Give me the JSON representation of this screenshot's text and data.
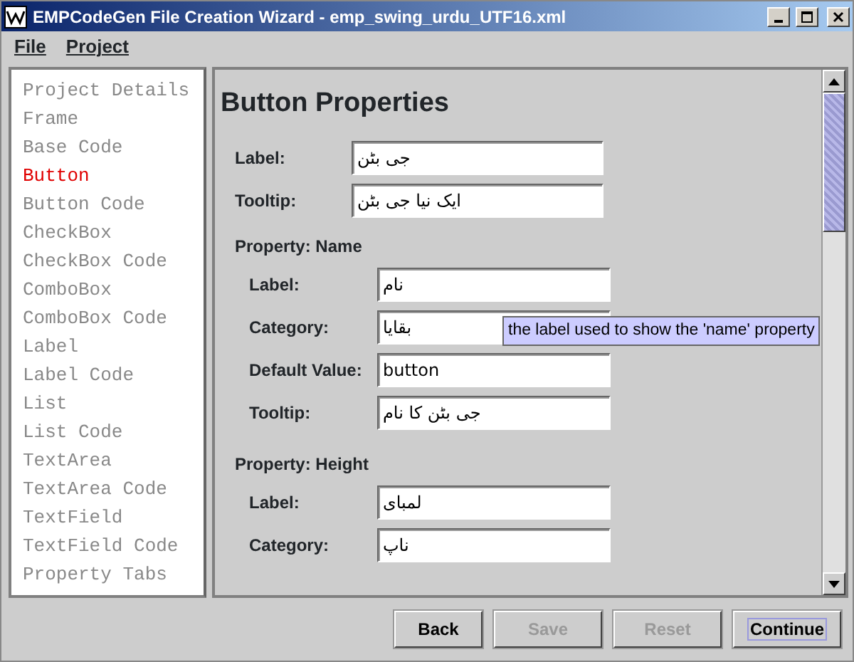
{
  "window": {
    "title": "EMPCodeGen File Creation Wizard - emp_swing_urdu_UTF16.xml"
  },
  "menu": [
    "File",
    "Project"
  ],
  "steps": [
    {
      "label": "Project Details",
      "selected": false
    },
    {
      "label": "Frame",
      "selected": false
    },
    {
      "label": "Base Code",
      "selected": false
    },
    {
      "label": "Button",
      "selected": true
    },
    {
      "label": "Button Code",
      "selected": false
    },
    {
      "label": "CheckBox",
      "selected": false
    },
    {
      "label": "CheckBox Code",
      "selected": false
    },
    {
      "label": "ComboBox",
      "selected": false
    },
    {
      "label": "ComboBox Code",
      "selected": false
    },
    {
      "label": "Label",
      "selected": false
    },
    {
      "label": "Label Code",
      "selected": false
    },
    {
      "label": "List",
      "selected": false
    },
    {
      "label": "List Code",
      "selected": false
    },
    {
      "label": "TextArea",
      "selected": false
    },
    {
      "label": "TextArea Code",
      "selected": false
    },
    {
      "label": "TextField",
      "selected": false
    },
    {
      "label": "TextField Code",
      "selected": false
    },
    {
      "label": "Property Tabs",
      "selected": false
    }
  ],
  "heading": "Button Properties",
  "fields": [
    {
      "label": "Label:",
      "value": "جی بٹن"
    },
    {
      "label": "Tooltip:",
      "value": "ایک نیا جی بٹن"
    }
  ],
  "sections": [
    {
      "title": "Property: Name",
      "fields": [
        {
          "label": "Label:",
          "value": "نام"
        },
        {
          "label": "Category:",
          "value": "بقایا"
        },
        {
          "label": "Default Value:",
          "value": "button"
        },
        {
          "label": "Tooltip:",
          "value": "جی بٹن کا نام"
        }
      ]
    },
    {
      "title": "Property: Height",
      "fields": [
        {
          "label": "Label:",
          "value": "لمبای"
        },
        {
          "label": "Category:",
          "value": "ناپ"
        }
      ]
    }
  ],
  "tooltip": "the label used to show the 'name' property",
  "buttons": [
    {
      "label": "Back",
      "disabled": false,
      "focused": false
    },
    {
      "label": "Save",
      "disabled": true,
      "focused": false
    },
    {
      "label": "Reset",
      "disabled": true,
      "focused": false
    },
    {
      "label": "Continue",
      "disabled": false,
      "focused": true
    }
  ]
}
